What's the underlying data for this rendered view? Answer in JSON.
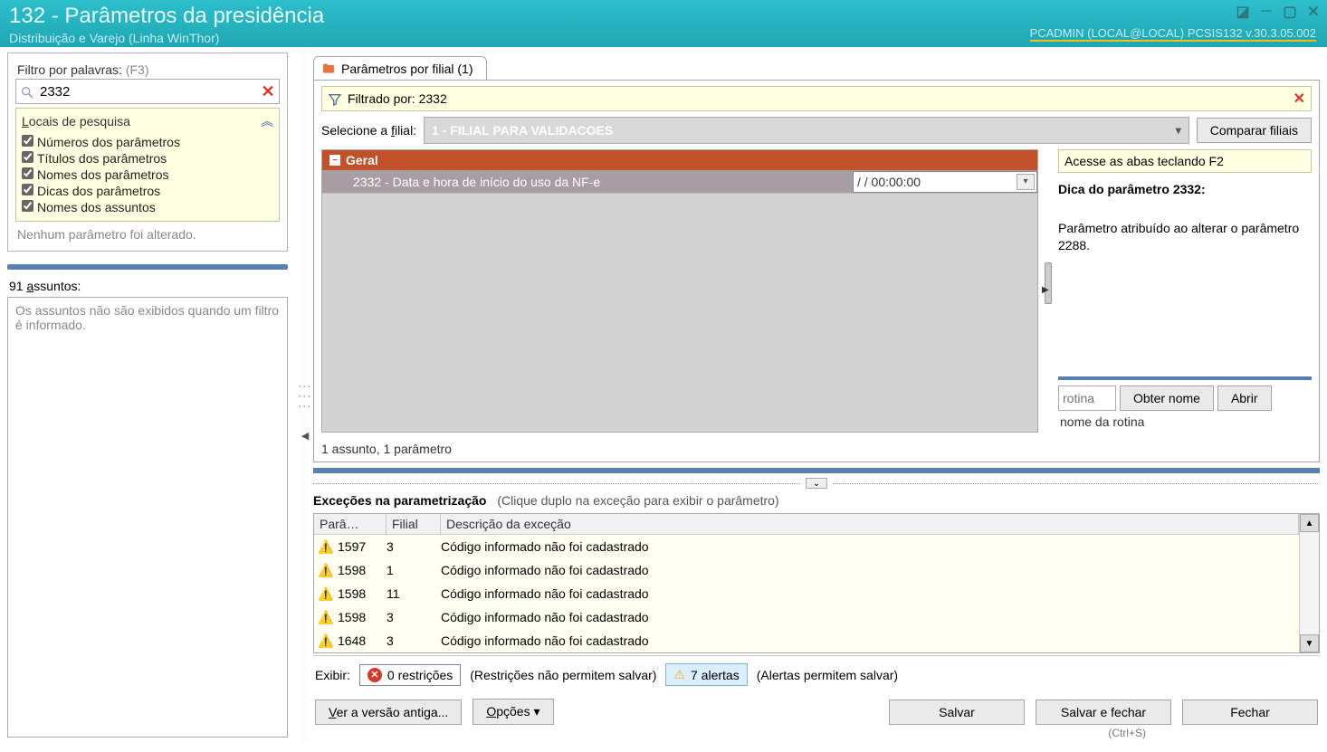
{
  "window": {
    "title": "132 - Parâmetros da presidência",
    "subtitle": "Distribuição e Varejo (Linha WinThor)",
    "user_info": "PCADMIN (LOCAL@LOCAL)   PCSIS132  v.30.3.05.002"
  },
  "sidebar": {
    "filter_label": "Filtro por palavras:",
    "filter_shortcut": "(F3)",
    "search_value": "2332",
    "locais_header": "Locais de pesquisa",
    "checks": [
      {
        "label": "Números dos parâmetros",
        "checked": true
      },
      {
        "label": "Títulos dos parâmetros",
        "checked": true
      },
      {
        "label": "Nomes dos parâmetros",
        "checked": true
      },
      {
        "label": "Dicas dos parâmetros",
        "checked": true
      },
      {
        "label": "Nomes dos assuntos",
        "checked": true
      }
    ],
    "no_change_text": "Nenhum parâmetro foi alterado.",
    "assuntos_label": "91 assuntos:",
    "assuntos_text": "Os assuntos não são exibidos quando um filtro é informado."
  },
  "tab": {
    "label": "Parâmetros por filial  (1)"
  },
  "filter_banner": {
    "text": "Filtrado por: 2332"
  },
  "filial_row": {
    "label": "Selecione a filial:",
    "selected": "1 - FILIAL PARA VALIDACOES",
    "compare_btn": "Comparar filiais"
  },
  "group_header": "Geral",
  "param": {
    "label": "2332 - Data e hora de início do uso da NF-e",
    "value": "  /  /      00:00:00"
  },
  "side_panel": {
    "access_hint": "Acesse as abas teclando F2",
    "dica_title": "Dica do parâmetro 2332:",
    "dica_text": "Parâmetro atribuído ao alterar o parâmetro 2288.",
    "rotina_placeholder": "rotina",
    "obter_btn": "Obter nome",
    "abrir_btn": "Abrir",
    "rotina_name": "nome da rotina"
  },
  "count_line": "1 assunto, 1 parâmetro",
  "exceptions": {
    "title": "Exceções na parametrização",
    "hint": "(Clique duplo na exceção para exibir o parâmetro)",
    "cols": {
      "param": "Parâ…",
      "filial": "Filial",
      "desc": "Descrição da exceção"
    },
    "rows": [
      {
        "param": "1597",
        "filial": "3",
        "desc": "Código informado não foi cadastrado"
      },
      {
        "param": "1598",
        "filial": "1",
        "desc": "Código informado não foi cadastrado"
      },
      {
        "param": "1598",
        "filial": "11",
        "desc": "Código informado não foi cadastrado"
      },
      {
        "param": "1598",
        "filial": "3",
        "desc": "Código informado não foi cadastrado"
      },
      {
        "param": "1648",
        "filial": "3",
        "desc": "Código informado não foi cadastrado"
      }
    ]
  },
  "display_row": {
    "label": "Exibir:",
    "restricoes_count": "0 restrições",
    "restricoes_hint": "(Restrições não permitem salvar)",
    "alertas_count": "7 alertas",
    "alertas_hint": "(Alertas permitem salvar)"
  },
  "bottom": {
    "ver_antiga": "Ver a versão antiga...",
    "opcoes": "Opções",
    "salvar": "Salvar",
    "salvar_fechar": "Salvar e fechar",
    "fechar": "Fechar",
    "salvar_shortcut": "(Ctrl+S)"
  }
}
